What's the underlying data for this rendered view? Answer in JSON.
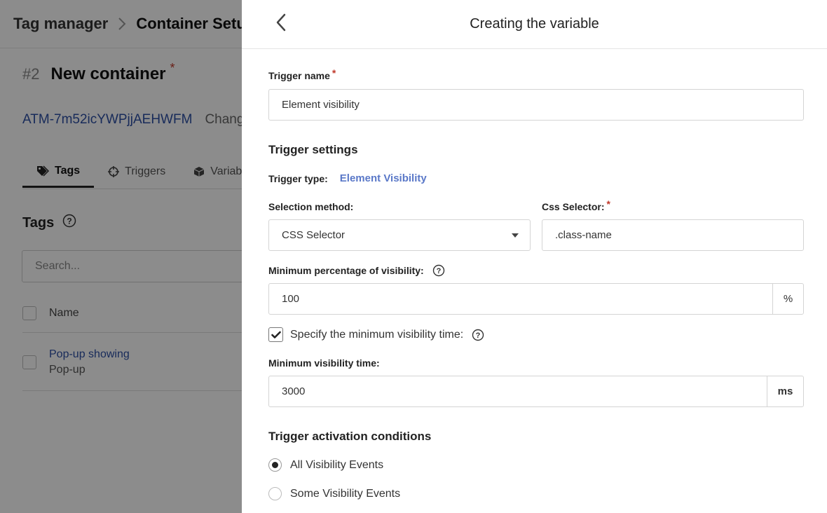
{
  "background": {
    "breadcrumb": {
      "root": "Tag manager",
      "current": "Container Setu"
    },
    "container": {
      "number": "#2",
      "title": "New container",
      "required_mark": "*"
    },
    "id_row": {
      "id": "ATM-7m52icYWPjjAEHWFM",
      "change": "Chang"
    },
    "tabs": [
      {
        "label": "Tags",
        "icon": "tags-icon",
        "active": true
      },
      {
        "label": "Triggers",
        "icon": "crosshair-icon",
        "active": false
      },
      {
        "label": "Variabl",
        "icon": "cube-icon",
        "active": false
      }
    ],
    "section_title": "Tags",
    "search_placeholder": "Search...",
    "list_header": "Name",
    "list_items": [
      {
        "title": "Pop-up showing",
        "subtitle": "Pop-up"
      }
    ]
  },
  "drawer": {
    "title": "Creating the variable",
    "trigger_name": {
      "label": "Trigger name",
      "required_mark": "*",
      "value": "Element visibility"
    },
    "settings_title": "Trigger settings",
    "trigger_type": {
      "label": "Trigger type:",
      "value": "Element Visibility"
    },
    "selection_method": {
      "label": "Selection method:",
      "value": "CSS Selector"
    },
    "css_selector": {
      "label": "Css Selector:",
      "required_mark": "*",
      "value": ".class-name"
    },
    "min_percentage": {
      "label": "Minimum percentage of visibility:",
      "value": "100",
      "unit": "%"
    },
    "specify_time": {
      "label": "Specify the minimum visibility time:",
      "checked": true
    },
    "min_time": {
      "label": "Minimum visibility time:",
      "value": "3000",
      "unit": "ms"
    },
    "activation_title": "Trigger activation conditions",
    "activation_options": [
      {
        "label": "All Visibility Events",
        "selected": true
      },
      {
        "label": "Some Visibility Events",
        "selected": false
      }
    ]
  },
  "colors": {
    "accent_link": "#5a78c8",
    "required": "#c0392b",
    "overlay": "rgba(0,0,0,0.45)"
  }
}
